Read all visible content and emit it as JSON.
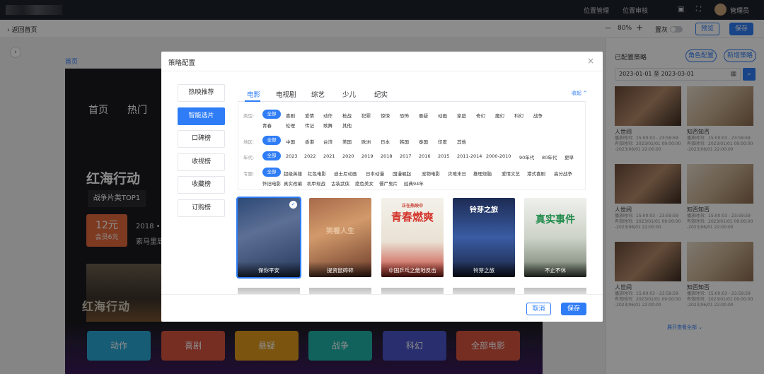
{
  "topbar": {
    "nav1": "位置管理",
    "nav2": "位置审核",
    "user": "管理员"
  },
  "toolbar": {
    "back": "返回首页",
    "zoom": "80%",
    "minus": "—",
    "plus": "+",
    "gray_label": "置灰",
    "preview": "预览",
    "save": "保存"
  },
  "canvas": {
    "crumb": "首页",
    "nav": [
      "首页",
      "热门"
    ],
    "hero_title": "红海行动",
    "hero_tag": "战争片类TOP1",
    "price_main": "12元",
    "price_sub": "会员6元",
    "year": "2018 •",
    "place": "索马里局",
    "poster_text": "红海行动",
    "categories": [
      "动作",
      "喜剧",
      "悬疑",
      "战争",
      "科幻",
      "全部电影"
    ],
    "category_colors": [
      "#2aa8d6",
      "#d8533f",
      "#e09a1e",
      "#1fb3a8",
      "#4a54c8",
      "#d8533f"
    ]
  },
  "side": {
    "title": "已配置策略",
    "role_btn": "角色配置",
    "new_btn": "新增策略",
    "date_range": "2023-01-01 至 2023-03-01",
    "cards": [
      {
        "title": "人世间",
        "lines": [
          "播放时间：15:00:03 - 23:59:59",
          "有效时间：2023/01/01 09:00:00",
          "-2023/06/01 22:00:00"
        ]
      },
      {
        "title": "知否知否",
        "lines": [
          "播放时间：15:00:03 - 23:59:59",
          "有效时间：2023/01/01 09:00:00",
          "-2023/06/01 22:00:00"
        ]
      },
      {
        "title": "人世间",
        "lines": [
          "播放时间：15:00:03 - 23:59:59",
          "有效时间：2023/01/01 09:00:00",
          "-2023/06/01 22:00:00"
        ]
      },
      {
        "title": "知否知否",
        "lines": [
          "播放时间：15:00:03 - 23:59:59",
          "有效时间：2023/01/01 09:00:00",
          "-2023/06/01 22:00:00"
        ]
      },
      {
        "title": "人世间",
        "lines": [
          "播放时间：15:00:03 - 23:59:59",
          "有效时间：2023/01/01 09:00:00",
          "-2023/06/01 22:00:00"
        ]
      },
      {
        "title": "知否知否",
        "lines": [
          "播放时间：15:00:03 - 23:59:59",
          "有效时间：2023/01/01 09:00:00",
          "-2023/06/01 22:00:00"
        ]
      }
    ],
    "more": "展开查看全部 ⌄"
  },
  "modal": {
    "title": "策略配置",
    "close": "×",
    "left_nav": [
      "热映推荐",
      "智能选片",
      "口碑榜",
      "收视榜",
      "收藏榜",
      "订购榜"
    ],
    "tabs": [
      "电影",
      "电视剧",
      "综艺",
      "少儿",
      "纪实"
    ],
    "collapse": "收起 ^",
    "filters": {
      "type_label": "类型:",
      "type_row1": [
        "全部",
        "喜剧",
        "爱情",
        "动作",
        "枪战",
        "犯罪",
        "惊悚",
        "恐怖",
        "悬疑",
        "动画",
        "家庭",
        "奇幻",
        "魔幻",
        "科幻",
        "战争"
      ],
      "type_row2": [
        "青春",
        "伦理",
        "传记",
        "歌舞",
        "其他"
      ],
      "region_label": "地区:",
      "region": [
        "全部",
        "中国",
        "香港",
        "台湾",
        "美国",
        "欧洲",
        "日本",
        "韩国",
        "泰国",
        "印度",
        "其他"
      ],
      "year_label": "年代:",
      "year": [
        "全部",
        "2023",
        "2022",
        "2021",
        "2020",
        "2019",
        "2018",
        "2017",
        "2016",
        "2015",
        "2011-2014",
        "2000-2010",
        "90年代",
        "80年代",
        "更早"
      ],
      "topic_label": "专题:",
      "topic_row1": [
        "全部",
        "超级英雄",
        "红色电影",
        "迪士尼动画",
        "日本动漫",
        "国漫崛起",
        "宠物电影",
        "灾难末日",
        "推理烧脑",
        "爱情文艺",
        "港式喜剧",
        "高分战争"
      ],
      "topic_row2": [
        "怀旧电影",
        "真实改编",
        "机甲现战",
        "古装武侠",
        "绝色美女",
        "僵尸鬼片",
        "经典94年"
      ]
    },
    "movies": [
      {
        "title": "保你平安",
        "poster": ""
      },
      {
        "title": "提资鼠碎碎",
        "poster": "笑看人生"
      },
      {
        "title": "中国乒乓之绝地反击",
        "poster": "青春燃爽",
        "tag": "正在热映中"
      },
      {
        "title": "铃芽之旅",
        "poster": "铃芽之旅"
      },
      {
        "title": "不止不休",
        "poster": "真实事件"
      }
    ],
    "cancel": "取消",
    "save": "保存"
  }
}
